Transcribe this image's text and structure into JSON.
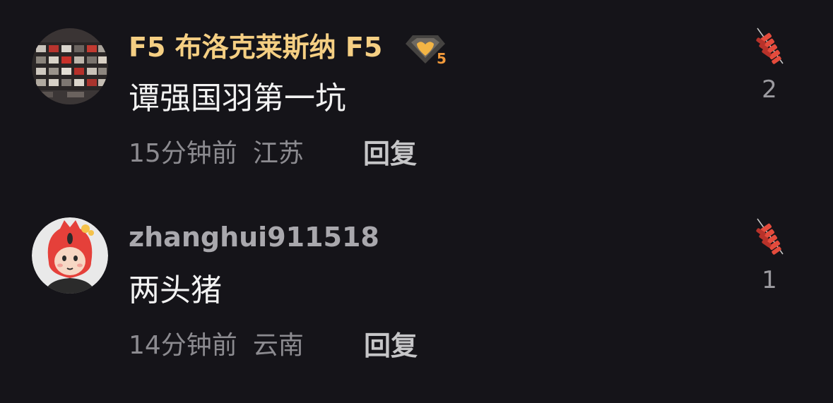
{
  "colors": {
    "background": "#151419",
    "username_vip": "#f5cf83",
    "username_normal": "#a9a8ad",
    "text": "#f2f2f2",
    "meta": "#8c8b90",
    "reply": "#c6c6c8",
    "like_firecracker": "#e44b3c"
  },
  "comments": [
    {
      "username": "F5 布洛克莱斯纳 F5",
      "badge_icon": "gold-heart-level-icon",
      "badge_level": "5",
      "text": "谭强国羽第一坑",
      "time": "15分钟前",
      "location": "江苏",
      "reply_label": "回复",
      "like_icon": "firecracker-icon",
      "likes": "2"
    },
    {
      "username": "zhanghui911518",
      "text": "两头猪",
      "time": "14分钟前",
      "location": "云南",
      "reply_label": "回复",
      "like_icon": "firecracker-icon",
      "likes": "1"
    }
  ]
}
